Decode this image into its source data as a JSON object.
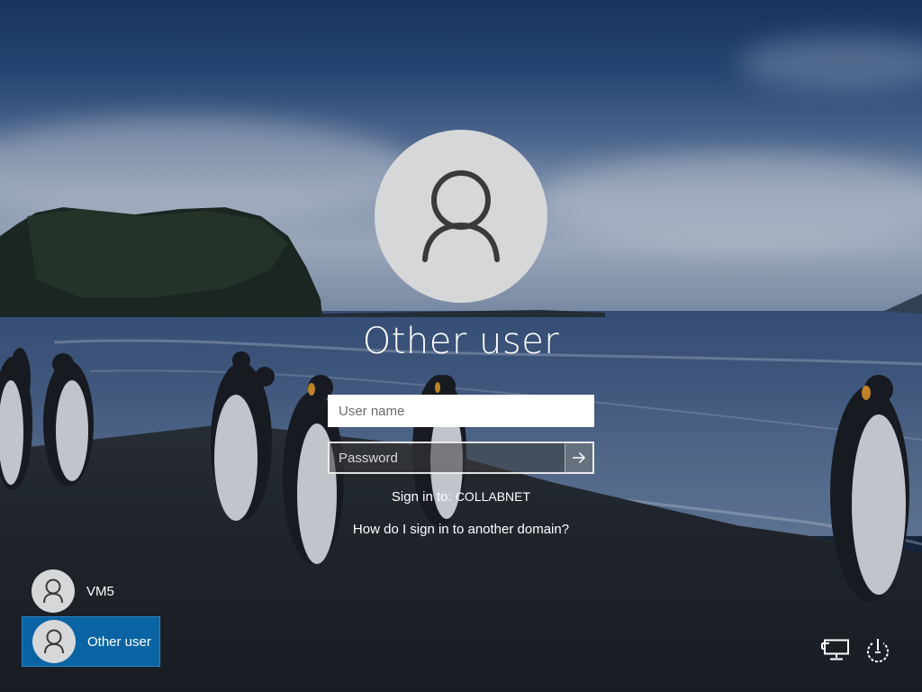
{
  "signin": {
    "title": "Other user",
    "username_placeholder": "User name",
    "password_placeholder": "Password",
    "sign_in_to_prefix": "Sign in to:",
    "domain": "COLLABNET",
    "other_domain_link": "How do I sign in to another domain?"
  },
  "users": [
    {
      "label": "VM5",
      "selected": false
    },
    {
      "label": "Other user",
      "selected": true
    }
  ],
  "icons": {
    "avatar": "user-silhouette-icon",
    "submit": "arrow-right-icon",
    "network": "network-icon",
    "power": "power-icon"
  },
  "colors": {
    "selected_tile": "#0a64a4",
    "avatar_bg": "#d6d7d9"
  }
}
